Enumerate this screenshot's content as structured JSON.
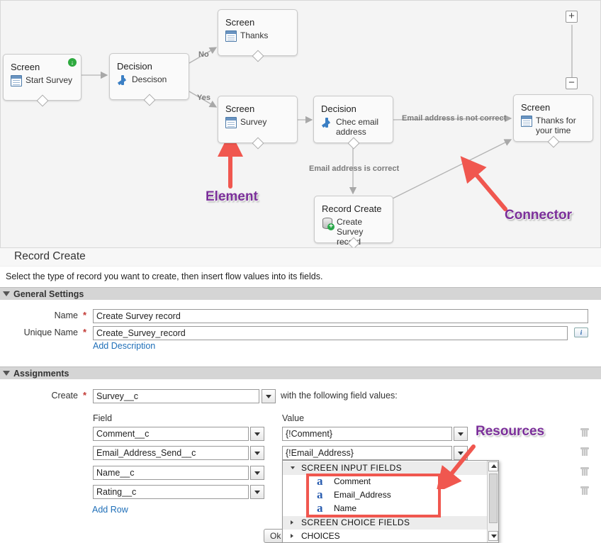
{
  "canvas": {
    "nodes": {
      "start": {
        "type": "Screen",
        "label": "Start Survey"
      },
      "decision1": {
        "type": "Decision",
        "label": "Descison"
      },
      "thanks": {
        "type": "Screen",
        "label": "Thanks"
      },
      "survey": {
        "type": "Screen",
        "label": "Survey"
      },
      "check": {
        "type": "Decision",
        "label_line1": "Chec email",
        "label_line2": "address"
      },
      "thanks_time": {
        "type": "Screen",
        "label_line1": "Thanks for",
        "label_line2": "your time"
      },
      "record": {
        "type": "Record Create",
        "label_line1": "Create Survey",
        "label_line2": "record"
      }
    },
    "connectors": {
      "no": "No",
      "yes": "Yes",
      "not_correct": "Email address is not correct",
      "correct": "Email address is correct"
    },
    "callouts": {
      "element": "Element",
      "connector": "Connector",
      "resources": "Resources"
    },
    "zoom": {
      "plus": "+",
      "minus": "−"
    },
    "colors": {
      "callout_text": "#7b2f9a",
      "arrow": "#f0574f",
      "start_badge": "#2eaa3f"
    }
  },
  "panel": {
    "title": "Record Create",
    "intro": "Select the type of record you want to create, then insert flow values into its fields.",
    "general": {
      "header": "General Settings",
      "name_label": "Name",
      "name_value": "Create Survey record",
      "unique_label": "Unique Name",
      "unique_value": "Create_Survey_record",
      "add_description": "Add Description",
      "info": "i"
    },
    "assignments": {
      "header": "Assignments",
      "create_label": "Create",
      "object_value": "Survey__c",
      "with_text": "with the following field values:",
      "field_header": "Field",
      "value_header": "Value",
      "rows": [
        {
          "field": "Comment__c",
          "value": "{!Comment}"
        },
        {
          "field": "Email_Address_Send__c",
          "value": "{!Email_Address}"
        },
        {
          "field": "Name__c",
          "value": ""
        },
        {
          "field": "Rating__c",
          "value": ""
        }
      ],
      "add_row": "Add Row",
      "ok": "Ok"
    },
    "dropdown": {
      "group1": "SCREEN INPUT FIELDS",
      "items": [
        "Comment",
        "Email_Address",
        "Name"
      ],
      "group2": "SCREEN CHOICE FIELDS",
      "group3": "CHOICES",
      "item_icon": "a"
    }
  }
}
